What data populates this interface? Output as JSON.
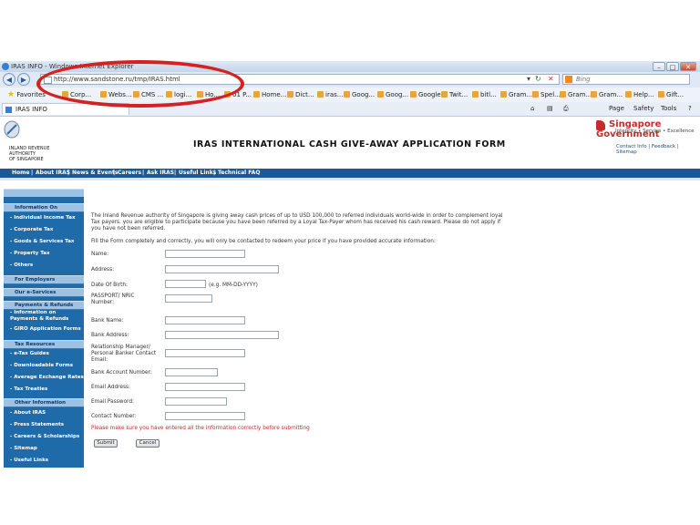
{
  "window": {
    "title": "IRAS INFO - Windows Internet Explorer"
  },
  "address": {
    "url": "http://www.sandstone.ru/tmp/IRAS.html",
    "search_placeholder": "Bing"
  },
  "favorites": {
    "label": "Favorites",
    "items": [
      "Corp...",
      "Webs...",
      "CMS ...",
      "logi...",
      "Ho...",
      "01 P...",
      "Home...",
      "Dict...",
      "iras...",
      "Goog...",
      "Goog...",
      "Google",
      "Twit...",
      "bitl...",
      "Gram...",
      "Spel...",
      "Gram...",
      "Gram...",
      "Help...",
      "Gift..."
    ]
  },
  "tab": {
    "label": "IRAS INFO"
  },
  "commandbar": {
    "page": "Page",
    "safety": "Safety",
    "tools": "Tools"
  },
  "header": {
    "agency": [
      "INLAND REVENUE",
      "AUTHORITY",
      "OF SINGAPORE"
    ],
    "title": "IRAS INTERNATIONAL CASH GIVE-AWAY APPLICATION FORM",
    "gov": "Singapore Government",
    "tagline": "Integrity • Service • Excellence",
    "links": "Contact Info |  Feedback |  Sitemap"
  },
  "topnav": [
    "Home",
    "About IRAS",
    "News & Events",
    "Careers",
    "Ask IRAS",
    "Useful Links",
    "Technical FAQ"
  ],
  "sidebar": {
    "information_on": "Information On",
    "info_items": [
      "- Individual Income Tax",
      "- Corporate Tax",
      "- Goods & Services Tax",
      "- Property Tax",
      "- Others"
    ],
    "for_employers": "For Employers",
    "our_eservices": "Our e-Services",
    "payments": "Payments & Refunds",
    "payments_items": [
      "- Information on Payments & Refunds",
      "- GIRO Application Forms"
    ],
    "tax_resources": "Tax Resources",
    "tax_items": [
      "- e-Tax Guides",
      "- Downloadable Forms",
      "- Average Exchange Rates",
      "- Tax Treaties"
    ],
    "other_info": "Other Information",
    "other_items": [
      "- About IRAS",
      "- Press Statements",
      "- Careers & Scholarships",
      "- Sitemap",
      "- Useful Links"
    ]
  },
  "form": {
    "intro": "The Inland Revenue authority of Singapore is giving away cash prices of up to USD 100,000 to referred individuals world-wide in order to complement loyal Tax payers. you are eligible to participate because you have been referred by a Loyal Tax-Payer whom has received his cash reward. Please do not apply if you have not been referred.",
    "instruction": "Fill the Form completely and correctly, you will only be contacted to redeem your price if you have provided accurate information:",
    "labels": {
      "name": "Name:",
      "address": "Address:",
      "dob": "Date Of Birth:",
      "passport": "PASSPORT/ NRIC Number:",
      "bank_name": "Bank Name:",
      "bank_address": "Bank Address:",
      "relationship_manager": "Relationship Manager/ Personal Banker Contact Email:",
      "account_number": "Bank Account Number:",
      "email": "Email Address:",
      "email_password": "Email Password:",
      "contact_number": "Contact Number:"
    },
    "dob_hint": "(e.g. MM-DD-YYYY)",
    "warning": "Please make sure you have entered all the information correctly before submitting",
    "submit": "Submit",
    "cancel": "Cancel"
  },
  "colors": {
    "nav_blue": "#1d5795",
    "sidebar_blue": "#1f6aa9",
    "sidebar_header": "#9dc2e3",
    "warning_red": "#c32a2a",
    "annotation_red": "#d42121"
  }
}
